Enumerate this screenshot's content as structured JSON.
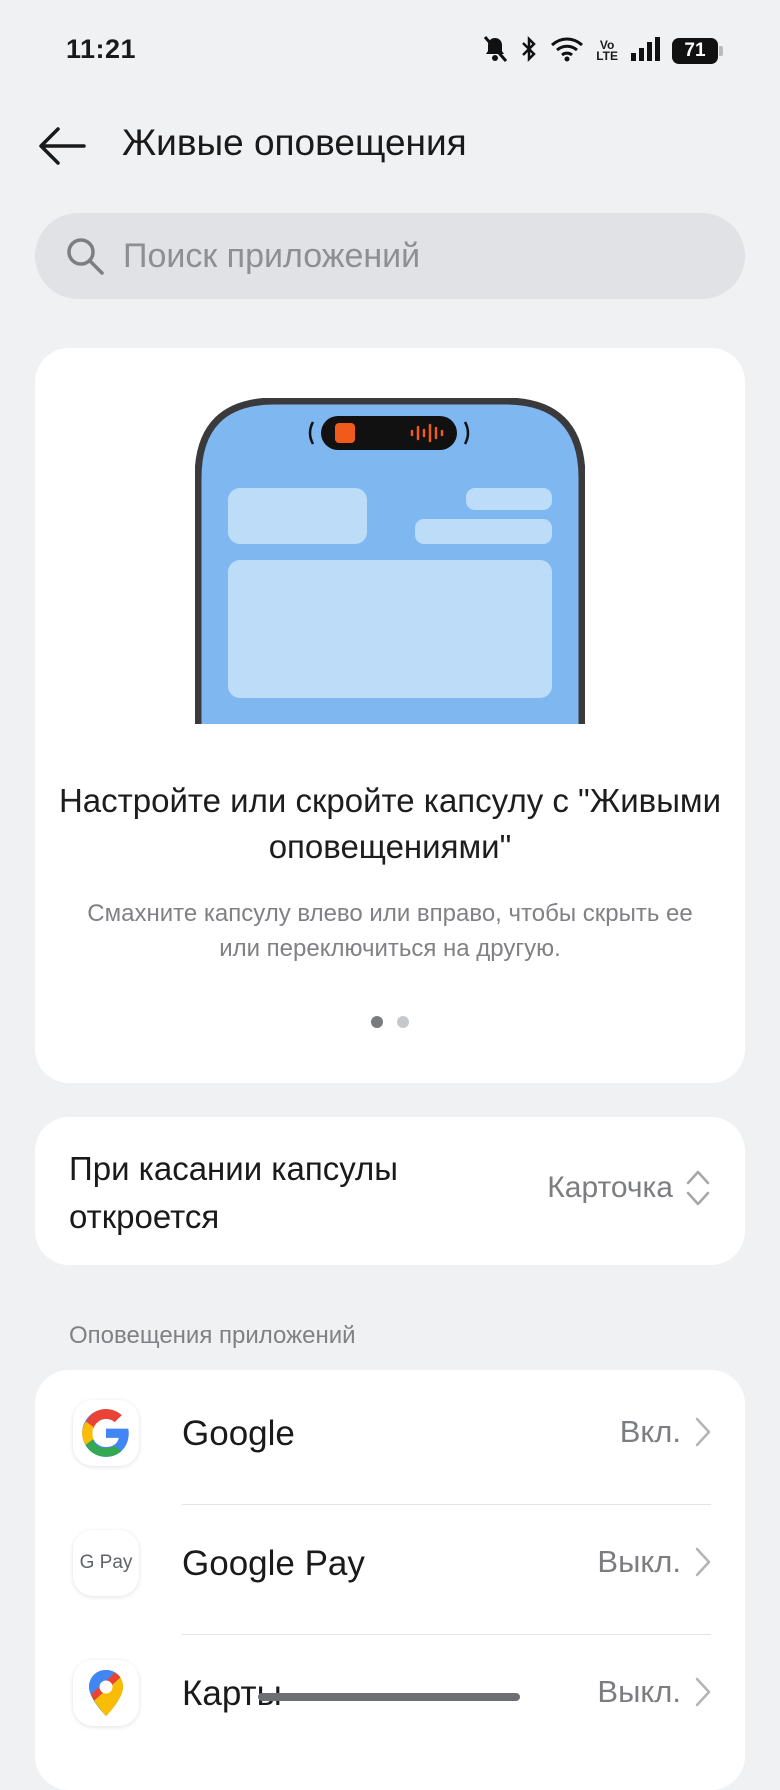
{
  "status_bar": {
    "time": "11:21",
    "volte": "Vo\nLTE",
    "battery": "71"
  },
  "header": {
    "title": "Живые оповещения"
  },
  "search": {
    "placeholder": "Поиск приложений"
  },
  "hero": {
    "title": "Настройте или скройте капсулу с \"Живыми оповещениями\"",
    "subtitle": "Смахните капсулу влево или вправо, чтобы скрыть ее или переключиться на другую.",
    "page_count": 2,
    "active_page": 1
  },
  "tap_setting": {
    "label": "При касании капсулы откроется",
    "value": "Карточка"
  },
  "apps_section": {
    "label": "Оповещения приложений",
    "items": [
      {
        "name": "Google",
        "status": "Вкл.",
        "icon": "google-icon"
      },
      {
        "name": "Google Pay",
        "status": "Выкл.",
        "icon": "google-pay-icon",
        "icon_text": "G Pay"
      },
      {
        "name": "Карты",
        "status": "Выкл.",
        "icon": "google-maps-icon"
      }
    ]
  },
  "colors": {
    "background": "#f0f1f3",
    "card": "#ffffff",
    "phone_screen": "#7fb8f0",
    "capsule_accent": "#f05a1a"
  }
}
